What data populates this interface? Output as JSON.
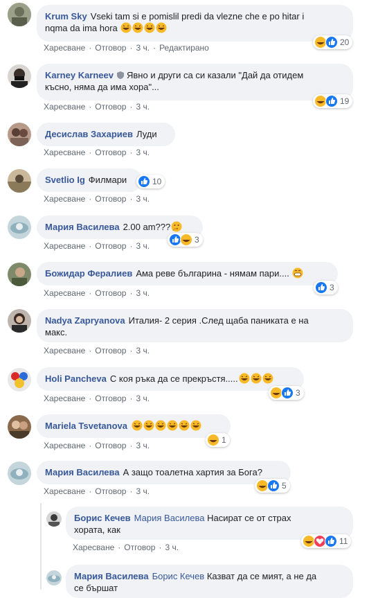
{
  "colors": {
    "accent": "#385898",
    "bubble": "#f0f2f5",
    "meta": "#606770",
    "like": "#1877f2",
    "haha": "#f7b928",
    "love": "#f33e58"
  },
  "labels": {
    "like": "Харесване",
    "reply": "Отговор",
    "edited": "Редактирано"
  },
  "comments": [
    {
      "name": "Krum Sky",
      "text": "Vseki tam si e pomislil predi da vlezne che e po hitar i",
      "text2": "nqma da ima hora",
      "emoji_count": 4,
      "time": "3 ч.",
      "reactions": [
        "haha",
        "like"
      ],
      "reaction_count": "20",
      "edited": true
    },
    {
      "name": "Karney Karneev",
      "text": "Явно и други са си казали \"Дай да отидем",
      "text2": "късно, няма да има хора\"...",
      "time": "3 ч.",
      "reactions": [
        "haha",
        "like"
      ],
      "reaction_count": "19",
      "badge": "shield-icon"
    },
    {
      "name": "Десислав Захариев",
      "text": "Луди",
      "time": "3 ч."
    },
    {
      "name": "Svetlio Ig",
      "text": "Филмари",
      "time": "3 ч.",
      "reactions": [
        "like"
      ],
      "reaction_count": "10"
    },
    {
      "name": "Мария Василева",
      "text": "2.00 am???",
      "emoji": "thinking-emoji",
      "time": "3 ч.",
      "reactions": [
        "like",
        "haha"
      ],
      "reaction_count": "3"
    },
    {
      "name": "Божидар Фералиев",
      "text": "Ама реве българина - нямам пари....",
      "emoji": "grin-emoji",
      "time": "3 ч.",
      "reactions": [
        "like"
      ],
      "reaction_count": "3"
    },
    {
      "name": "Nadya Zapryanova",
      "text": "Италия- 2 серия .След щаба паниката е на",
      "text2": "макс.",
      "time": "3 ч."
    },
    {
      "name": "Holi Pancheva",
      "text": "С коя ръка да се прекръстя.....",
      "emoji_count": 3,
      "time": "3 ч.",
      "reactions": [
        "haha",
        "like"
      ],
      "reaction_count": "3"
    },
    {
      "name": "Mariela Tsvetanova",
      "text": "",
      "emoji_count": 6,
      "time": "3 ч.",
      "reactions": [
        "haha"
      ],
      "reaction_count": "1"
    },
    {
      "name": "Мария Василева",
      "text": "А защо тоалетна хартия за Бога?",
      "time": "3 ч.",
      "reactions": [
        "haha",
        "like"
      ],
      "reaction_count": "5"
    }
  ],
  "replies": [
    {
      "name": "Борис Кечев",
      "mention": "Мария Василева",
      "text": "Насират се от страх",
      "text2": "хората, как",
      "time": "3 ч.",
      "reactions": [
        "haha",
        "love",
        "like"
      ],
      "reaction_count": "11"
    },
    {
      "name": "Мария Василева",
      "mention": "Борис Кечев",
      "text": "Казват да се мият, а не да",
      "text2": "се бършат"
    }
  ]
}
